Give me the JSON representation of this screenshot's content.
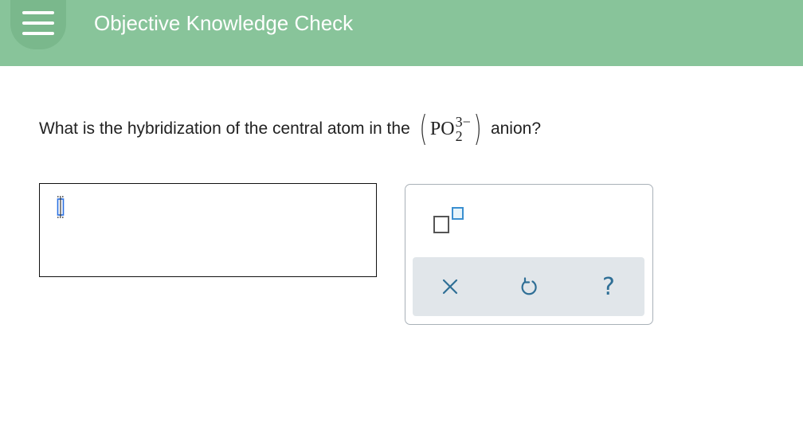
{
  "header": {
    "title": "Objective Knowledge Check",
    "menu_icon": "hamburger-menu-icon"
  },
  "question": {
    "text_before": "What is the hybridization of the central atom in the",
    "formula": {
      "base": "PO",
      "subscript": "2",
      "superscript": "3−"
    },
    "text_after": "anion?"
  },
  "answer": {
    "value": ""
  },
  "toolbar": {
    "superscript_icon": "superscript-box-icon",
    "clear_icon": "clear-x-icon",
    "undo_icon": "undo-icon",
    "help_label": "?"
  },
  "colors": {
    "header_bg": "#88c49a",
    "accent_blue": "#3a8fd0"
  }
}
